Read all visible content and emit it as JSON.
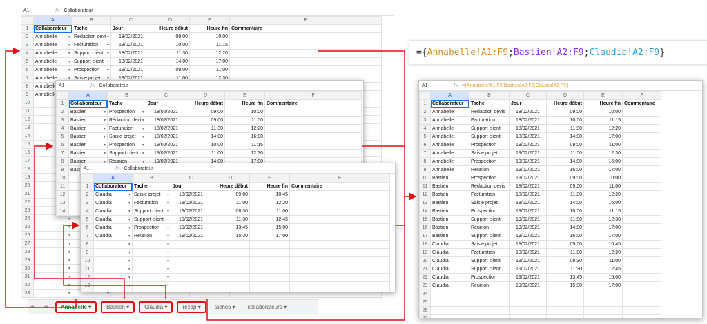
{
  "columns": [
    "A",
    "B",
    "C",
    "D",
    "E",
    "F"
  ],
  "headers": [
    "Collaborateur",
    "Tache",
    "Jour",
    "Heure début",
    "Heure fin",
    "Commentaire"
  ],
  "cell_ref": "A1",
  "fx_symbol": "fx",
  "sheets": {
    "annabelle": {
      "formula_value": "Collaborateur",
      "rows": [
        [
          "Annabelle",
          "Rédaction devi",
          "18/02/2021",
          "09:00",
          "10:00",
          ""
        ],
        [
          "Annabelle",
          "Facturation",
          "18/02/2021",
          "10:00",
          "11:15",
          ""
        ],
        [
          "Annabelle",
          "Support client",
          "18/02/2021",
          "11:30",
          "12:20",
          ""
        ],
        [
          "Annabelle",
          "Support client",
          "18/02/2021",
          "14:00",
          "17:00",
          ""
        ],
        [
          "Annabelle",
          "Prospection",
          "19/02/2021",
          "09:00",
          "11:00",
          ""
        ],
        [
          "Annabelle",
          "Saisie projet",
          "19/02/2021",
          "11:00",
          "12:30",
          ""
        ],
        [
          "Annabelle",
          "",
          "",
          "",
          "",
          ""
        ],
        [
          "Annabelle",
          "",
          "",
          "",
          "",
          ""
        ]
      ],
      "row_numbers": [
        "1",
        "2",
        "3",
        "4",
        "5",
        "6",
        "7",
        "8",
        "9",
        "10",
        "11",
        "12",
        "13",
        "14",
        "15",
        "16",
        "17",
        "18",
        "19",
        "20",
        "21",
        "22",
        "23",
        "24",
        "25",
        "26",
        "27",
        "28",
        "29",
        "30",
        "31",
        "32",
        "33",
        "34",
        "35"
      ]
    },
    "bastien": {
      "formula_value": "Collaborateur",
      "rows": [
        [
          "Bastien",
          "Prospection",
          "18/02/2021",
          "09:00",
          "10:00",
          ""
        ],
        [
          "Bastien",
          "Rédaction devi",
          "18/02/2021",
          "09:00",
          "11:00",
          ""
        ],
        [
          "Bastien",
          "Facturation",
          "18/02/2021",
          "11:30",
          "12:20",
          ""
        ],
        [
          "Bastien",
          "Saisie projet",
          "18/02/2021",
          "14:00",
          "16:00",
          ""
        ],
        [
          "Bastien",
          "Prospection",
          "19/02/2021",
          "10:00",
          "11:15",
          ""
        ],
        [
          "Bastien",
          "Support client",
          "19/02/2021",
          "11:00",
          "12:30",
          ""
        ],
        [
          "Bastien",
          "Réunion",
          "19/02/2021",
          "14:00",
          "17:00",
          ""
        ],
        [
          "Bastien",
          "",
          "",
          "",
          "",
          ""
        ]
      ],
      "row_numbers": [
        "1",
        "2",
        "3",
        "4",
        "5",
        "6",
        "7",
        "8",
        "9",
        "10",
        "11",
        "12",
        "13",
        "14",
        "15",
        "16",
        "17"
      ]
    },
    "claudia": {
      "formula_value": "Collaborateur",
      "rows": [
        [
          "Claudia",
          "Saisie projet",
          "18/02/2021",
          "09:00",
          "10:45",
          ""
        ],
        [
          "Claudia",
          "Facturation",
          "18/02/2021",
          "11:00",
          "12:20",
          ""
        ],
        [
          "Claudia",
          "Support client",
          "19/02/2021",
          "08:30",
          "11:00",
          ""
        ],
        [
          "Claudia",
          "Support client",
          "19/02/2021",
          "11:30",
          "12:45",
          ""
        ],
        [
          "Claudia",
          "Prospection",
          "19/02/2021",
          "13:45",
          "15:00",
          ""
        ],
        [
          "Claudia",
          "Réunion",
          "19/02/2021",
          "15:30",
          "17:00",
          ""
        ]
      ],
      "row_numbers": [
        "1",
        "2",
        "3",
        "4",
        "5",
        "6",
        "7",
        "8",
        "9",
        "10",
        "11",
        "12",
        "13",
        "14",
        "15"
      ]
    },
    "recap": {
      "formula_value": "={Annabelle!A1:F9;Bastien!A2:F9;Claudia!A2:F9}",
      "rows": [
        [
          "Annabelle",
          "Rédaction devis",
          "18/02/2021",
          "09:00",
          "10:00",
          ""
        ],
        [
          "Annabelle",
          "Facturation",
          "18/02/2021",
          "10:00",
          "11:15",
          ""
        ],
        [
          "Annabelle",
          "Support client",
          "18/02/2021",
          "11:30",
          "12:20",
          ""
        ],
        [
          "Annabelle",
          "Support client",
          "18/02/2021",
          "14:00",
          "17:00",
          ""
        ],
        [
          "Annabelle",
          "Prospection",
          "19/02/2021",
          "09:00",
          "11:00",
          ""
        ],
        [
          "Annabelle",
          "Saisie projet",
          "19/02/2021",
          "11:00",
          "12:30",
          ""
        ],
        [
          "Annabelle",
          "Prospection",
          "19/02/2021",
          "14:00",
          "16:00",
          ""
        ],
        [
          "Annabelle",
          "Réunion",
          "19/02/2021",
          "16:00",
          "17:00",
          ""
        ],
        [
          "Bastien",
          "Prospection",
          "18/02/2021",
          "09:00",
          "10:00",
          ""
        ],
        [
          "Bastien",
          "Rédaction devis",
          "18/02/2021",
          "09:00",
          "11:00",
          ""
        ],
        [
          "Bastien",
          "Facturation",
          "18/02/2021",
          "11:30",
          "12:20",
          ""
        ],
        [
          "Bastien",
          "Saisie projet",
          "18/02/2021",
          "14:00",
          "16:00",
          ""
        ],
        [
          "Bastien",
          "Prospection",
          "19/02/2021",
          "10:00",
          "11:15",
          ""
        ],
        [
          "Bastien",
          "Support client",
          "19/02/2021",
          "11:00",
          "12:30",
          ""
        ],
        [
          "Bastien",
          "Réunion",
          "19/02/2021",
          "14:00",
          "17:00",
          ""
        ],
        [
          "Bastien",
          "Support client",
          "19/02/2021",
          "16:00",
          "17:00",
          ""
        ],
        [
          "Claudia",
          "Saisie projet",
          "18/02/2021",
          "09:00",
          "10:45",
          ""
        ],
        [
          "Claudia",
          "Facturation",
          "18/02/2021",
          "11:00",
          "12:20",
          ""
        ],
        [
          "Claudia",
          "Support client",
          "19/02/2021",
          "08:30",
          "11:00",
          ""
        ],
        [
          "Claudia",
          "Support client",
          "19/02/2021",
          "11:30",
          "12:45",
          ""
        ],
        [
          "Claudia",
          "Prospection",
          "19/02/2021",
          "13:45",
          "15:00",
          ""
        ],
        [
          "Claudia",
          "Réunion",
          "19/02/2021",
          "15:30",
          "17:00",
          ""
        ]
      ],
      "row_numbers": [
        "1",
        "2",
        "3",
        "4",
        "5",
        "6",
        "7",
        "8",
        "9",
        "10",
        "11",
        "12",
        "13",
        "14",
        "15",
        "16",
        "17",
        "18",
        "19",
        "20",
        "21",
        "22",
        "23",
        "24",
        "25",
        "26",
        "27",
        "28"
      ]
    }
  },
  "big_formula": {
    "open": "={",
    "part1": "Annabelle!A1:F9",
    "sep1": ";",
    "part2": "Bastien!A2:F9",
    "sep2": ";",
    "part3": "Claudia!A2:F9",
    "close": "}"
  },
  "tabs": {
    "add_icon": "+",
    "list_icon": "≡",
    "items": [
      "Annabelle ▾",
      "Bastien ▾",
      "Claudia ▾",
      "recap ▾",
      "taches ▾",
      "collaborateurs ▾"
    ]
  },
  "colors": {
    "arrow": "#e01010",
    "select": "#1a73e8"
  }
}
